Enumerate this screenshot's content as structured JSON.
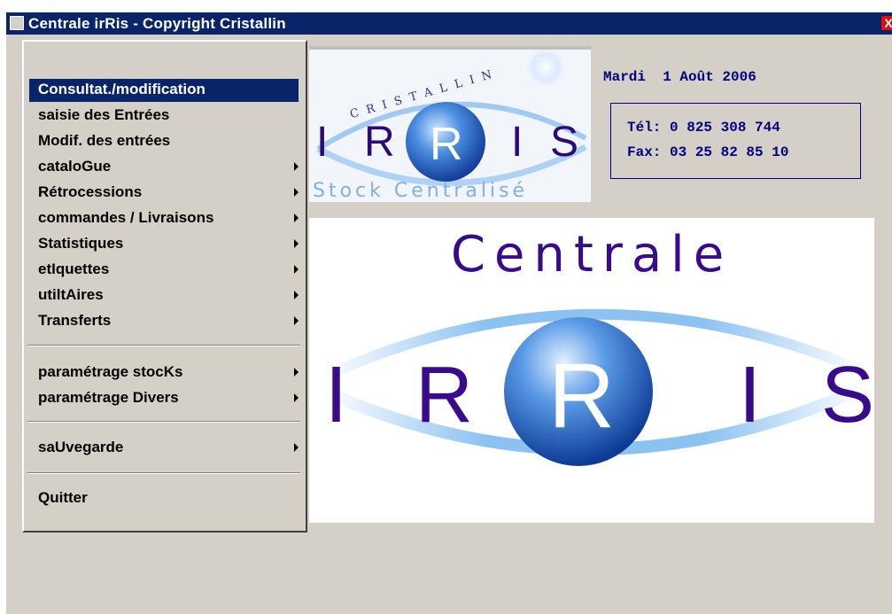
{
  "window": {
    "title": "Centrale irRis - Copyright Cristallin",
    "close_glyph": "X"
  },
  "menu": {
    "items": [
      {
        "label": "Consultat./modification",
        "submenu": false,
        "selected": true
      },
      {
        "label": "saisie des Entrées",
        "submenu": false
      },
      {
        "label": "Modif. des entrées",
        "submenu": false
      },
      {
        "label": "cataloGue",
        "submenu": true
      },
      {
        "label": "Rétrocessions",
        "submenu": true
      },
      {
        "label": "commandes / Livraisons",
        "submenu": true
      },
      {
        "label": "Statistiques",
        "submenu": true
      },
      {
        "label": "etIquettes",
        "submenu": true
      },
      {
        "label": "utiltAires",
        "submenu": true
      },
      {
        "label": "Transferts",
        "submenu": true
      }
    ],
    "items2": [
      {
        "label": "paramétrage stocKs",
        "submenu": true
      },
      {
        "label": "paramétrage Divers",
        "submenu": true
      }
    ],
    "items3": [
      {
        "label": "saUvegarde",
        "submenu": true
      }
    ],
    "items4": [
      {
        "label": "Quitter",
        "submenu": false
      }
    ]
  },
  "header": {
    "date": "Mardi  1 Août 2006",
    "tel": "Tél: 0 825 308 744",
    "fax": "Fax: 03 25 82 85 10"
  },
  "small_logo": {
    "arc_text": "CRISTALLIN",
    "letters": [
      "I",
      "R",
      "R",
      "I",
      "S"
    ],
    "tagline": "Stock Centralisé"
  },
  "big_logo": {
    "title": "Centrale",
    "letters": [
      "I",
      "R",
      "R",
      "I",
      "S"
    ]
  },
  "colors": {
    "titlebar": "#0a246a",
    "menu_bg": "#d4d0c8",
    "logo_purple": "#3a0a8c",
    "logo_blue": "#2a6fd0"
  }
}
